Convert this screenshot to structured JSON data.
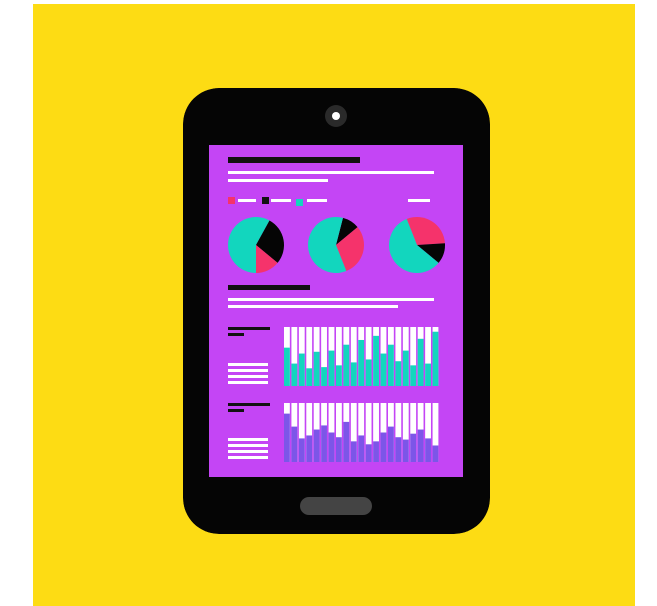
{
  "colors": {
    "background": "#FDDC14",
    "tablet_body": "#050505",
    "screen": "#C445F5",
    "line": "#FFFFFF",
    "dark_line": "#111111",
    "accent_pink": "#F5336B",
    "accent_teal": "#12D6BE",
    "accent_blue": "#7C56E8",
    "home_button": "#444444",
    "camera": "#2A2A2A"
  },
  "icons": {
    "camera": "camera-icon",
    "home": "home-button"
  },
  "chart_data": [
    {
      "type": "pie",
      "slices": [
        {
          "color": "#12D6BE",
          "value": 0.58
        },
        {
          "color": "#050505",
          "value": 0.28
        },
        {
          "color": "#F5336B",
          "value": 0.14
        }
      ]
    },
    {
      "type": "pie",
      "slices": [
        {
          "color": "#050505",
          "value": 0.1
        },
        {
          "color": "#F5336B",
          "value": 0.3
        },
        {
          "color": "#12D6BE",
          "value": 0.6
        }
      ]
    },
    {
      "type": "pie",
      "slices": [
        {
          "color": "#F5336B",
          "value": 0.3
        },
        {
          "color": "#050505",
          "value": 0.12
        },
        {
          "color": "#12D6BE",
          "value": 0.58
        }
      ]
    },
    {
      "type": "bar",
      "color": "#12D6BE",
      "values": [
        0.65,
        0.38,
        0.55,
        0.3,
        0.58,
        0.32,
        0.6,
        0.35,
        0.7,
        0.4,
        0.78,
        0.45,
        0.85,
        0.55,
        0.7,
        0.42,
        0.6,
        0.35,
        0.8,
        0.38,
        0.92
      ]
    },
    {
      "type": "bar",
      "color": "#7C56E8",
      "values": [
        0.82,
        0.6,
        0.4,
        0.45,
        0.55,
        0.62,
        0.5,
        0.42,
        0.68,
        0.35,
        0.45,
        0.3,
        0.35,
        0.5,
        0.6,
        0.42,
        0.38,
        0.48,
        0.55,
        0.4,
        0.28
      ]
    }
  ]
}
